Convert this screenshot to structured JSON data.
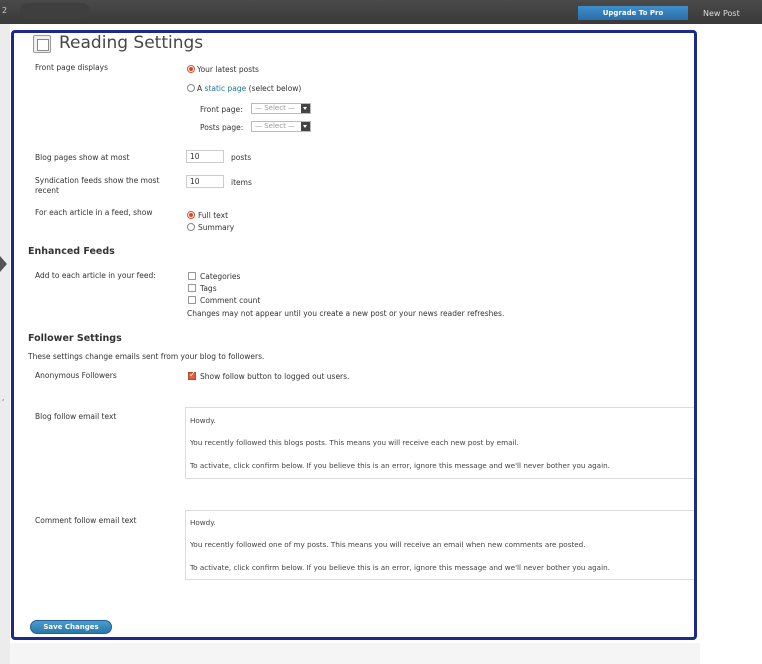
{
  "topbar": {
    "left_number": "2",
    "upgrade_label": "Upgrade To Pro",
    "new_post_label": "New Post"
  },
  "page": {
    "title": "Reading Settings"
  },
  "front_page": {
    "label": "Front page displays",
    "option_latest": "Your latest posts",
    "option_static_prefix": "A",
    "option_static_link": "static page",
    "option_static_suffix": "(select below)",
    "front_page_label": "Front page:",
    "posts_page_label": "Posts page:",
    "select_placeholder": "— Select —",
    "selected": "latest"
  },
  "blog_pages": {
    "label": "Blog pages show at most",
    "value": "10",
    "unit": "posts"
  },
  "syndication": {
    "label": "Syndication feeds show the most recent",
    "value": "10",
    "unit": "items"
  },
  "feed_article": {
    "label": "For each article in a feed, show",
    "option_full": "Full text",
    "option_summary": "Summary",
    "selected": "full"
  },
  "enhanced_feeds": {
    "heading": "Enhanced Feeds",
    "label": "Add to each article in your feed:",
    "options": [
      "Categories",
      "Tags",
      "Comment count"
    ],
    "note": "Changes may not appear until you create a new post or your news reader refreshes."
  },
  "follower": {
    "heading": "Follower Settings",
    "description": "These settings change emails sent from your blog to followers.",
    "anon_label": "Anonymous Followers",
    "anon_checkbox": "Show follow button to logged out users.",
    "blog_email_label": "Blog follow email text",
    "blog_email_lines": [
      "Howdy.",
      "You recently followed this blogs posts. This means you will receive each new post by email.",
      "To activate, click confirm below. If you believe this is an error, ignore this message and we'll never bother you again."
    ],
    "comment_email_label": "Comment follow email text",
    "comment_email_lines": [
      "Howdy.",
      "You recently followed one of my posts. This means you will receive an email when new comments are posted.",
      "To activate, click confirm below. If you believe this is an error, ignore this message and we'll never bother you again."
    ]
  },
  "save_label": "Save Changes",
  "colors": {
    "accent_blue": "#21759b",
    "highlight_frame": "#1c2a8a",
    "radio_checked": "#e0452a"
  }
}
